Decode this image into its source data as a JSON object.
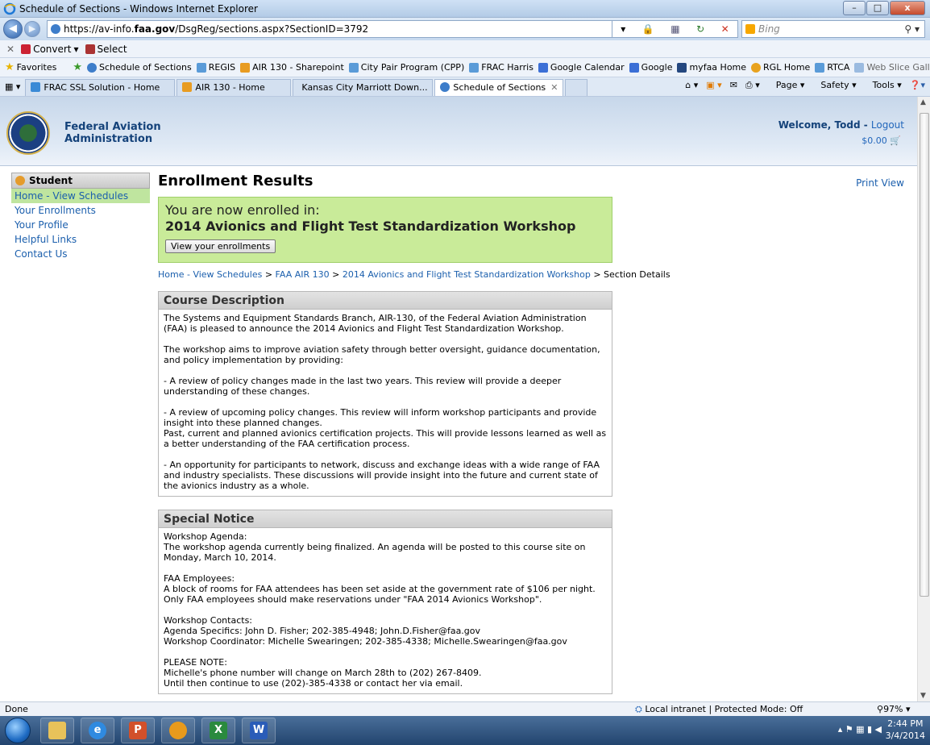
{
  "window": {
    "title": "Schedule of Sections - Windows Internet Explorer",
    "minimize": "–",
    "maximize": "□",
    "close": "x"
  },
  "address": {
    "prefix": "https://av-info.",
    "domain": "faa.gov",
    "path": "/DsgReg/sections.aspx?SectionID=3792",
    "search_placeholder": "Bing"
  },
  "commandbar": {
    "convert": "Convert",
    "select": "Select"
  },
  "favorites": {
    "label": "Favorites",
    "items": [
      "Schedule of Sections",
      "REGIS",
      "AIR 130 - Sharepoint",
      "City Pair Program (CPP)",
      "FRAC Harris",
      "Google Calendar",
      "Google",
      "myfaa Home",
      "RGL Home",
      "RTCA",
      "Web Slice Gallery"
    ]
  },
  "tabs": [
    "FRAC SSL Solution - Home",
    "AIR 130 - Home",
    "Kansas City Marriott Down...",
    "Schedule of Sections"
  ],
  "toolbar": {
    "page": "Page",
    "safety": "Safety",
    "tools": "Tools"
  },
  "header": {
    "agency_line1": "Federal Aviation",
    "agency_line2": "Administration",
    "welcome": "Welcome, Todd - ",
    "logout": "Logout",
    "cart": "$0.00"
  },
  "sidebar": {
    "title": "Student",
    "items": [
      "Home - View Schedules",
      "Your Enrollments",
      "Your Profile",
      "Helpful Links",
      "Contact Us"
    ]
  },
  "main": {
    "title": "Enrollment Results",
    "print_view": "Print View",
    "enrolled_line1": "You are now enrolled in:",
    "enrolled_course": "2014 Avionics and Flight Test Standardization Workshop",
    "view_enrollments": "View your enrollments",
    "breadcrumb": {
      "home": "Home - View Schedules",
      "sep": " > ",
      "program": "FAA AIR 130",
      "course": "2014 Avionics and Flight Test Standardization Workshop",
      "current": "Section Details"
    }
  },
  "course_description": {
    "heading": "Course Description",
    "paragraphs": [
      "The Systems and Equipment Standards Branch, AIR-130, of the Federal Aviation Administration (FAA) is pleased to announce the 2014 Avionics and Flight Test Standardization Workshop.",
      "The workshop aims to improve aviation safety through better oversight, guidance documentation, and policy implementation by providing:",
      "- A review of policy changes made in the last two years. This review will provide a deeper understanding of these changes.",
      "- A review of upcoming policy changes. This review will inform workshop participants and provide insight into these planned changes.",
      "Past, current and planned avionics certification projects. This will provide lessons learned as well as a better understanding of the FAA certification process.",
      "- An opportunity for participants to network, discuss and exchange ideas with a wide range of FAA and industry specialists. These discussions will provide insight into the future and current state of the avionics industry as a whole."
    ]
  },
  "special_notice": {
    "heading": "Special Notice",
    "agenda_title": "Workshop Agenda:",
    "agenda_text": "The workshop agenda currently being finalized. An agenda will be posted to this course site on Monday, March 10, 2014.",
    "faa_title": "FAA Employees:",
    "faa_text1": "A block of rooms for FAA attendees has been set aside at the government rate of $106 per night.",
    "faa_text2": "Only FAA employees should make reservations under \"FAA 2014 Avionics Workshop\".",
    "contacts_title": "Workshop Contacts:",
    "contacts_1": "Agenda Specifics: John D. Fisher; 202-385-4948; John.D.Fisher@faa.gov",
    "contacts_2": "Workshop Coordinator: Michelle Swearingen; 202-385-4338; Michelle.Swearingen@faa.gov",
    "note_title": "PLEASE NOTE:",
    "note_1": "Michelle's phone number will change on March 28th to (202) 267-8409.",
    "note_2": "Until then continue to use (202)-385-4338 or contact her via email."
  },
  "status": {
    "done": "Done",
    "zone": "Local intranet | Protected Mode: Off",
    "zoom": "97%"
  },
  "taskbar": {
    "time": "2:44 PM",
    "date": "3/4/2014"
  }
}
